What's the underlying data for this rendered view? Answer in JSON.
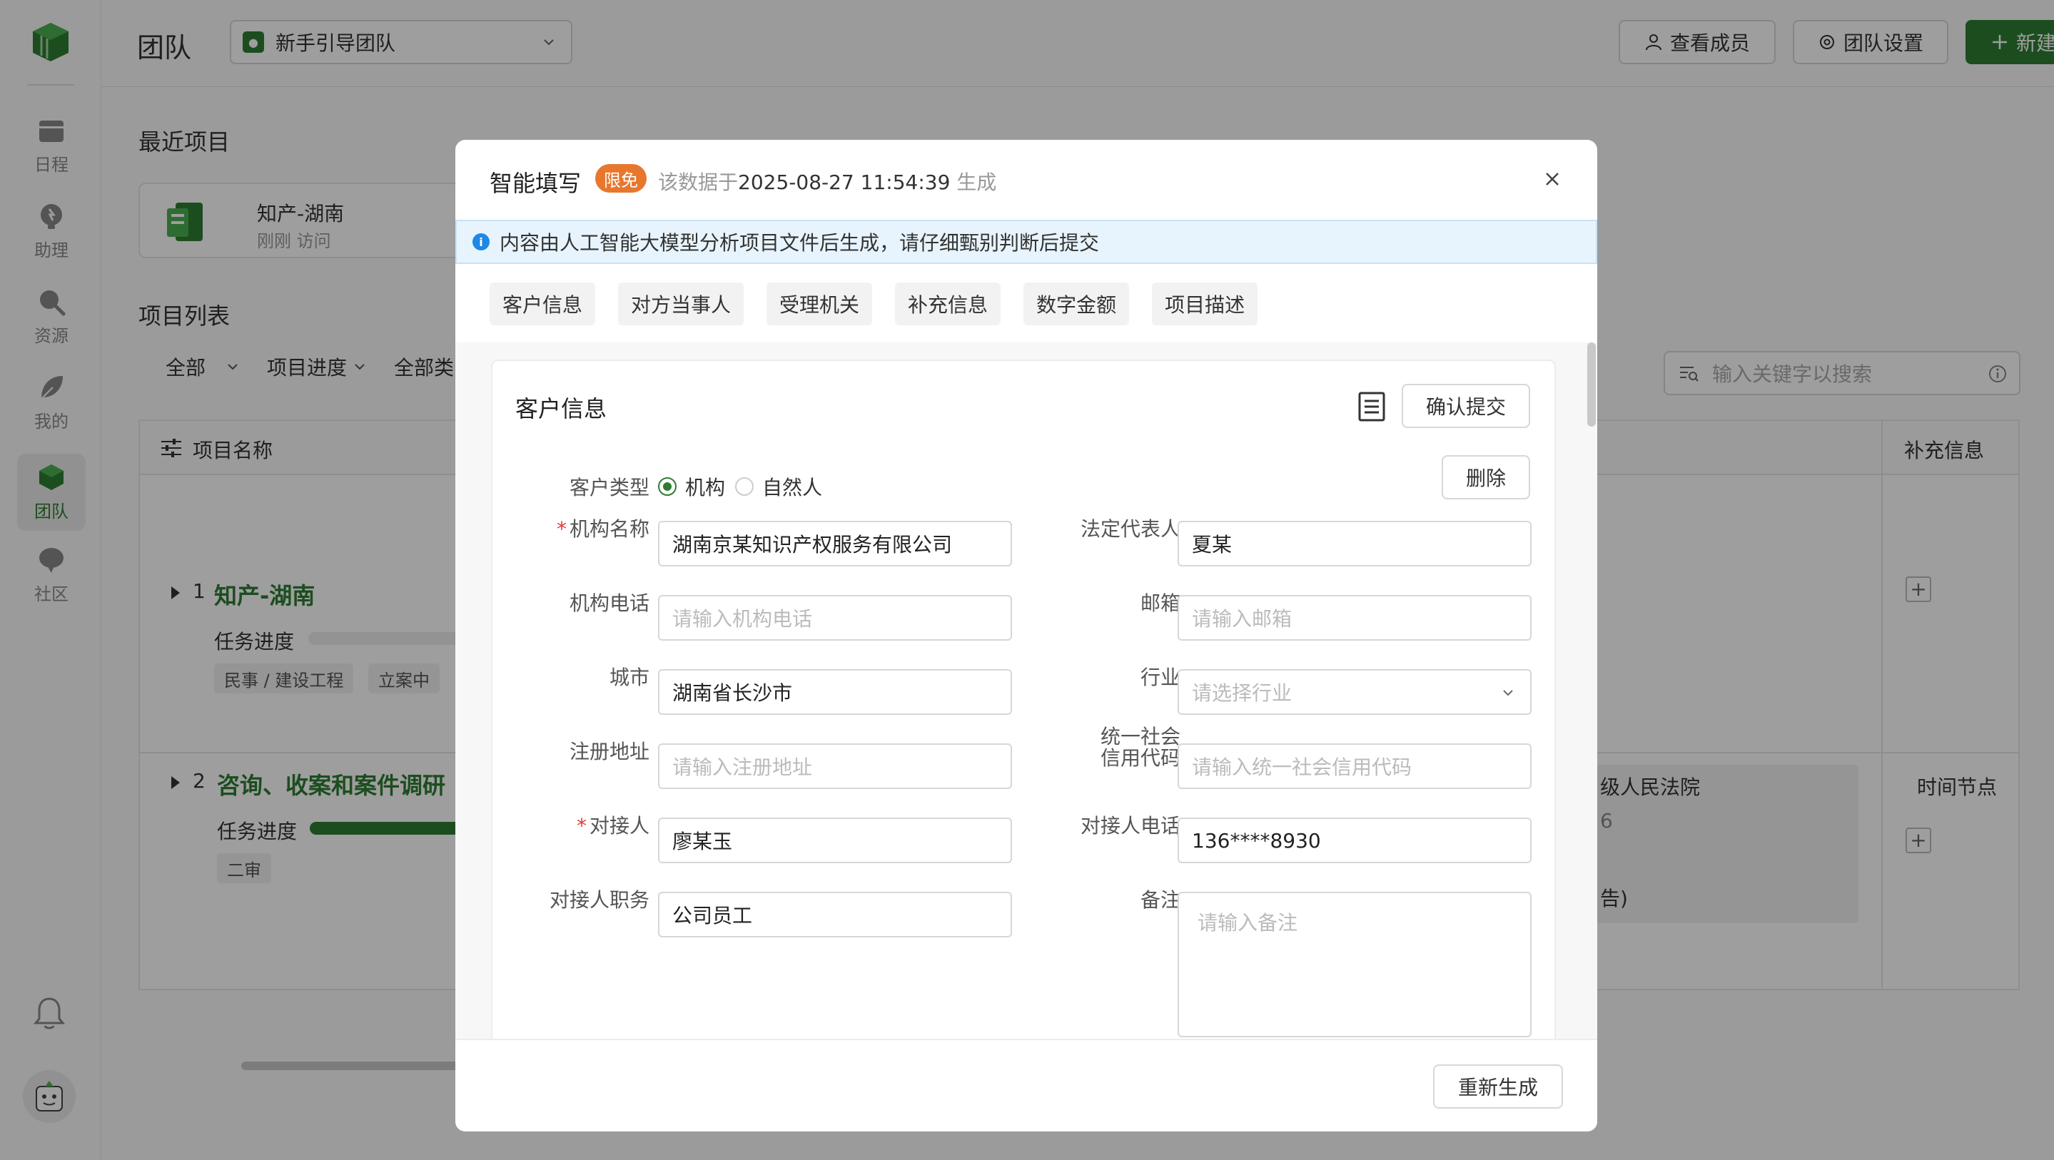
{
  "sidebar": {
    "items": [
      {
        "label": "日程",
        "icon": "calendar-icon"
      },
      {
        "label": "助理",
        "icon": "assistant-icon"
      },
      {
        "label": "资源",
        "icon": "search-icon"
      },
      {
        "label": "我的",
        "icon": "leaf-icon"
      },
      {
        "label": "团队",
        "icon": "cube-icon",
        "active": true
      },
      {
        "label": "社区",
        "icon": "chat-icon"
      }
    ]
  },
  "header": {
    "title": "团队",
    "team_select": "新手引导团队",
    "view_members": "查看成员",
    "team_settings": "团队设置",
    "new_project": "新建项目"
  },
  "recent": {
    "heading": "最近项目",
    "card_name": "知产-湖南",
    "card_sub": "刚刚 访问"
  },
  "project_list": {
    "heading": "项目列表",
    "filters": [
      "全部",
      "项目进度",
      "全部类"
    ],
    "search_placeholder": "输入关键字以搜索",
    "col_name": "项目名称",
    "col_supplement": "补充信息",
    "rows": [
      {
        "num": "1",
        "title": "知产-湖南",
        "task_label": "任务进度",
        "progress": 0.0,
        "tags": [
          "民事 / 建设工程",
          "立案中"
        ]
      },
      {
        "num": "2",
        "title": "咨询、收案和案件调研",
        "task_label": "任务进度",
        "progress": 0.6,
        "tags": [
          "二审"
        ],
        "court_snippet": "级人民法院",
        "snippet2": "6",
        "snippet3": "告)",
        "supplement": "时间节点"
      }
    ]
  },
  "modal": {
    "title": "智能填写",
    "badge": "限免",
    "generated_prefix": "该数据于",
    "generated_time": "2025-08-27 11:54:39",
    "generated_suffix": "生成",
    "notice": "内容由人工智能大模型分析项目文件后生成，请仔细甄别判断后提交",
    "tabs": [
      "客户信息",
      "对方当事人",
      "受理机关",
      "补充信息",
      "数字金额",
      "项目描述"
    ],
    "card_title": "客户信息",
    "confirm_button": "确认提交",
    "delete_button": "删除",
    "regenerate_button": "重新生成",
    "customer_type_label": "客户类型",
    "customer_type_options": [
      "机构",
      "自然人"
    ],
    "fields": {
      "org_name": {
        "label": "机构名称",
        "value": "湖南京某知识产权服务有限公司"
      },
      "legal_rep": {
        "label": "法定代表人",
        "value": "夏某"
      },
      "org_phone": {
        "label": "机构电话",
        "placeholder": "请输入机构电话"
      },
      "email": {
        "label": "邮箱",
        "placeholder": "请输入邮箱"
      },
      "city": {
        "label": "城市",
        "value": "湖南省长沙市"
      },
      "industry": {
        "label": "行业",
        "placeholder": "请选择行业"
      },
      "reg_address": {
        "label": "注册地址",
        "placeholder": "请输入注册地址"
      },
      "credit_code": {
        "label_line1": "统一社会",
        "label_line2": "信用代码",
        "placeholder": "请输入统一社会信用代码"
      },
      "contact": {
        "label": "对接人",
        "value": "廖某玉"
      },
      "contact_phone": {
        "label": "对接人电话",
        "value": "136****8930"
      },
      "contact_title": {
        "label": "对接人职务",
        "value": "公司员工"
      },
      "remark": {
        "label": "备注",
        "placeholder": "请输入备注"
      }
    }
  }
}
